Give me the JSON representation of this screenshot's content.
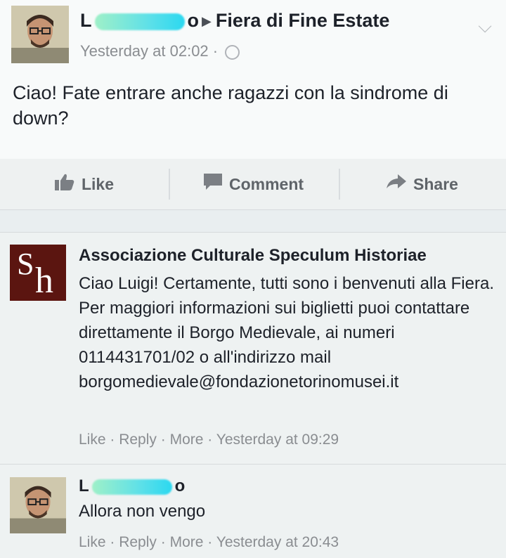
{
  "post": {
    "author_visible": "L",
    "author_tail": "o",
    "target": "Fiera di Fine Estate",
    "timestamp": "Yesterday at 02:02",
    "meta_sep": "·",
    "text": "Ciao! Fate entrare anche ragazzi con la sindrome di down?"
  },
  "actions": {
    "like": "Like",
    "comment": "Comment",
    "share": "Share"
  },
  "comments": [
    {
      "author": "Associazione Culturale Speculum Historiae",
      "logo_letters": [
        "S",
        "h"
      ],
      "text": "Ciao Luigi! Certamente, tutti sono i benvenuti alla Fiera. Per maggiori informazioni sui biglietti puoi contattare direttamente il Borgo Medievale, ai numeri 0114431701/02 o all'indirizzo mail borgomedievale@fondazionetorinomusei.it",
      "like": "Like",
      "reply": "Reply",
      "more": "More",
      "sep": " · ",
      "timestamp": "Yesterday at 09:29"
    },
    {
      "author_visible": "L",
      "author_tail": "o",
      "text": "Allora non vengo",
      "like": "Like",
      "reply": "Reply",
      "more": "More",
      "sep": " · ",
      "timestamp": "Yesterday at 20:43"
    }
  ],
  "icons": {
    "like": "thumbs-up-icon",
    "comment": "comment-icon",
    "share": "share-icon",
    "globe": "globe-icon",
    "chevron": "chevron-down-icon"
  }
}
